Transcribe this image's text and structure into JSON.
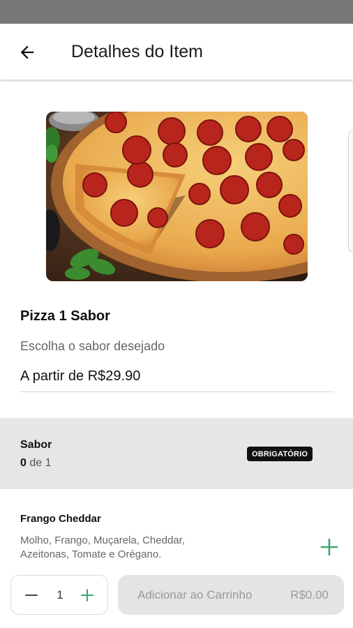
{
  "header": {
    "title": "Detalhes do Item",
    "back_icon": "arrow-left-icon"
  },
  "product": {
    "image_icon": "pepperoni-pizza-photo",
    "name": "Pizza 1 Sabor",
    "description": "Escolha o sabor desejado",
    "price": "A partir de R$29.90"
  },
  "section": {
    "title": "Sabor",
    "count_selected": "0",
    "count_rest": " de 1",
    "badge": "OBRIGATÓRIO"
  },
  "options": [
    {
      "name": "Frango Cheddar",
      "description": "Molho, Frango, Muçarela, Cheddar, Azeitonas, Tomate e Orégano.",
      "add_icon": "plus-icon"
    }
  ],
  "footer": {
    "quantity": "1",
    "minus_icon": "minus-icon",
    "plus_icon": "plus-icon",
    "add_to_cart_label": "Adicionar ao Carrinho",
    "add_to_cart_price": "R$0.00"
  },
  "colors": {
    "accent_green": "#3ea86a",
    "section_bg": "#e6e6e6",
    "badge_bg": "#111111",
    "status_bar": "#777777"
  }
}
